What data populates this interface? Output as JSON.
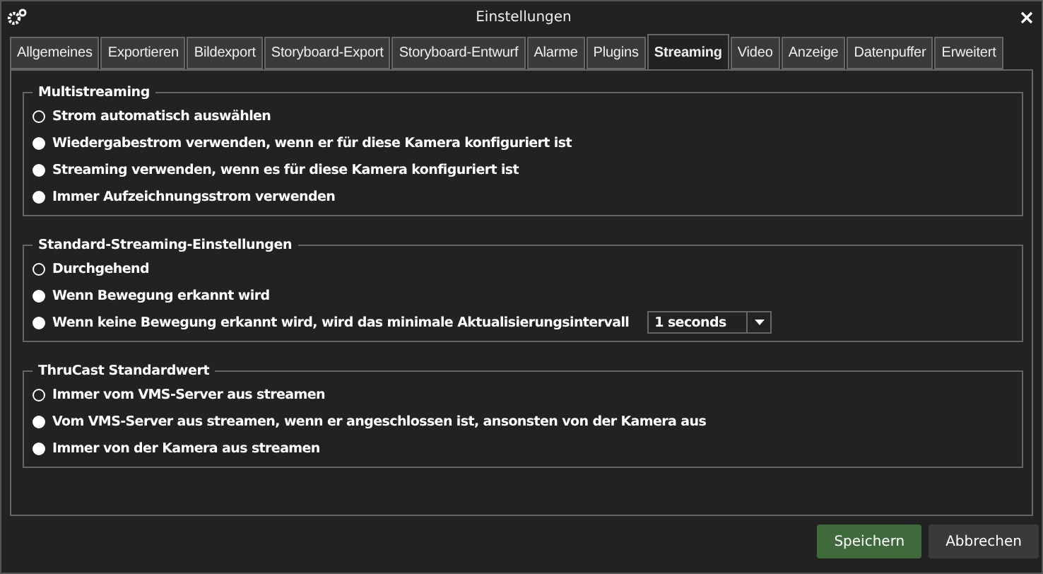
{
  "window": {
    "title": "Einstellungen"
  },
  "tabs": [
    {
      "label": "Allgemeines",
      "selected": false
    },
    {
      "label": "Exportieren",
      "selected": false
    },
    {
      "label": "Bildexport",
      "selected": false
    },
    {
      "label": "Storyboard-Export",
      "selected": false
    },
    {
      "label": "Storyboard-Entwurf",
      "selected": false
    },
    {
      "label": "Alarme",
      "selected": false
    },
    {
      "label": "Plugins",
      "selected": false
    },
    {
      "label": "Streaming",
      "selected": true
    },
    {
      "label": "Video",
      "selected": false
    },
    {
      "label": "Anzeige",
      "selected": false
    },
    {
      "label": "Datenpuffer",
      "selected": false
    },
    {
      "label": "Erweitert",
      "selected": false
    }
  ],
  "groups": [
    {
      "title": "Multistreaming",
      "options": [
        {
          "label": "Strom automatisch auswählen",
          "selected": true
        },
        {
          "label": "Wiedergabestrom verwenden, wenn er für diese Kamera konfiguriert ist",
          "selected": false
        },
        {
          "label": "Streaming verwenden, wenn es für diese Kamera konfiguriert ist",
          "selected": false
        },
        {
          "label": "Immer Aufzeichnungsstrom verwenden",
          "selected": false
        }
      ]
    },
    {
      "title": "Standard-Streaming-Einstellungen",
      "options": [
        {
          "label": "Durchgehend",
          "selected": true
        },
        {
          "label": "Wenn Bewegung erkannt wird",
          "selected": false
        },
        {
          "label": "Wenn keine Bewegung erkannt wird, wird das minimale Aktualisierungsintervall",
          "selected": false,
          "dropdown": "1 seconds"
        }
      ]
    },
    {
      "title": "ThruCast Standardwert",
      "options": [
        {
          "label": "Immer vom VMS-Server aus streamen",
          "selected": true
        },
        {
          "label": "Vom VMS-Server aus streamen, wenn er angeschlossen ist, ansonsten von der Kamera aus",
          "selected": false
        },
        {
          "label": "Immer von der Kamera aus streamen",
          "selected": false
        }
      ]
    }
  ],
  "buttons": [
    {
      "label": "Speichern",
      "kind": "primary"
    },
    {
      "label": "Abbrechen",
      "kind": "secondary"
    }
  ]
}
